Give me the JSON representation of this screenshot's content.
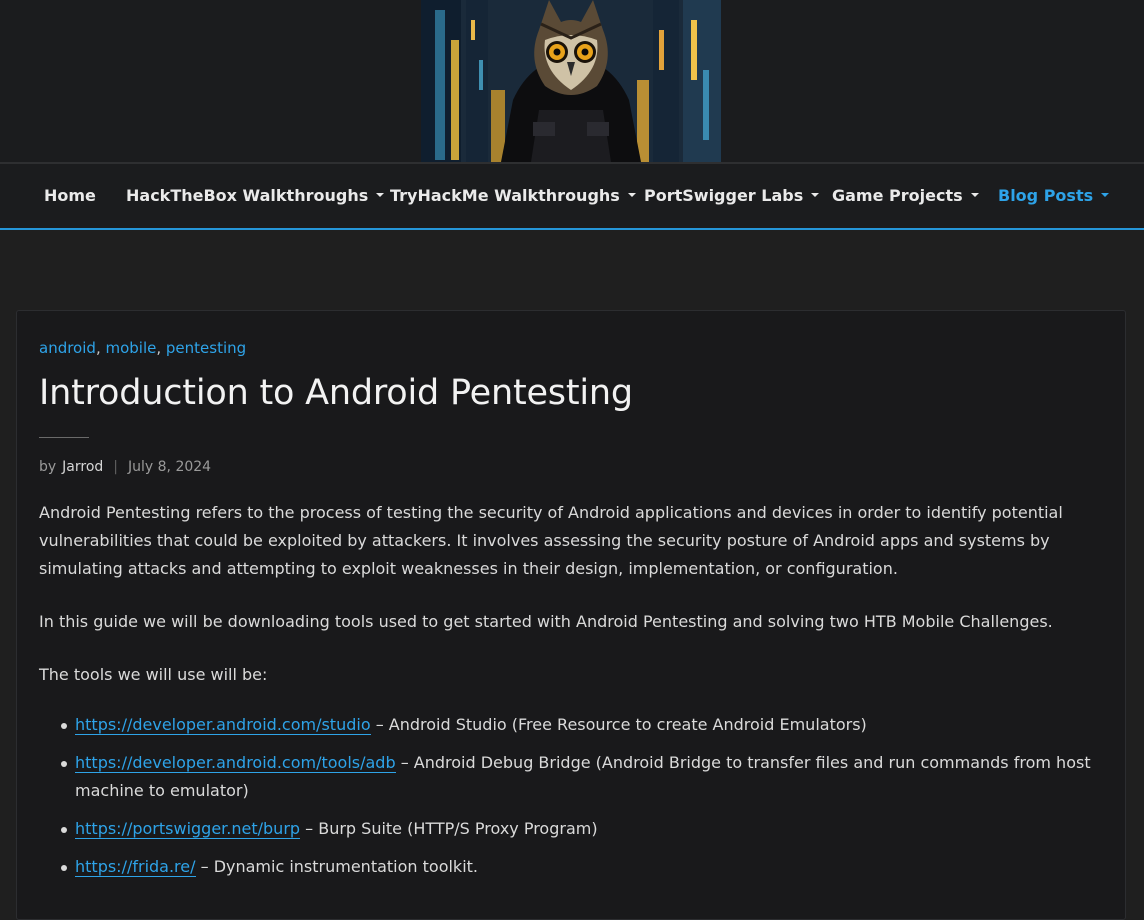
{
  "header": {
    "logo_alt": "owl-hacker-logo"
  },
  "nav": {
    "items": [
      {
        "label": "Home",
        "has_dropdown": false
      },
      {
        "label": "HackTheBox Walkthroughs",
        "has_dropdown": true
      },
      {
        "label": "TryHackMe Walkthroughs",
        "has_dropdown": true
      },
      {
        "label": "PortSwigger Labs",
        "has_dropdown": true
      },
      {
        "label": "Game Projects",
        "has_dropdown": true
      },
      {
        "label": "Blog Posts",
        "has_dropdown": true,
        "active": true
      }
    ]
  },
  "article": {
    "categories": [
      "android",
      "mobile",
      "pentesting"
    ],
    "title": "Introduction to Android Pentesting",
    "by_label": "by",
    "author": "Jarrod",
    "meta_separator": "|",
    "date": "July 8, 2024",
    "paragraphs": [
      "Android Pentesting refers to the process of testing the security of Android applications and devices in order to identify potential vulnerabilities that could be exploited by attackers. It involves assessing the security posture of Android apps and systems by simulating attacks and attempting to exploit weaknesses in their design, implementation, or configuration.",
      "In this guide we will be downloading tools used to get started with Android Pentesting and solving two HTB Mobile Challenges.",
      "The tools we will use will be:"
    ],
    "tools": [
      {
        "link": "https://developer.android.com/studio",
        "desc": " – Android Studio (Free Resource to create Android Emulators)"
      },
      {
        "link": "https://developer.android.com/tools/adb",
        "desc": " – Android Debug Bridge  (Android Bridge to transfer files and run commands from host machine to emulator)"
      },
      {
        "link": "https://portswigger.net/burp",
        "desc": " – Burp Suite (HTTP/S Proxy Program)"
      },
      {
        "link": "https://frida.re/",
        "desc": " – Dynamic instrumentation toolkit."
      }
    ]
  },
  "colors": {
    "accent": "#2ea3e8",
    "background": "#1f1f1f",
    "card": "#19191b"
  }
}
